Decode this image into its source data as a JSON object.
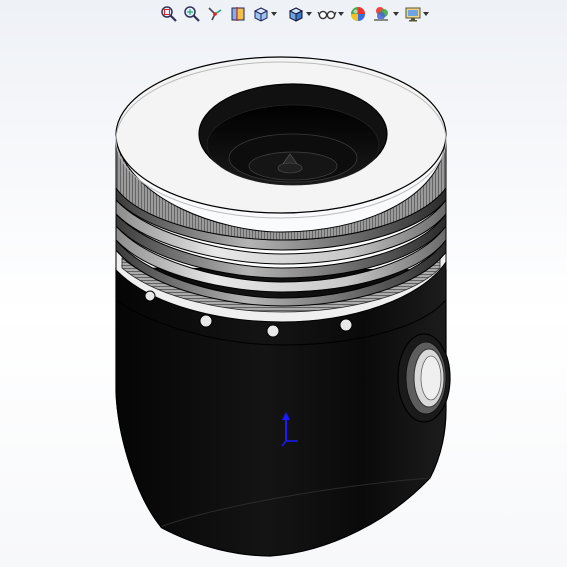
{
  "window": {
    "background_top": "#eef1f6",
    "background_bottom": "#ffffff"
  },
  "heads_up_toolbar": {
    "buttons": [
      {
        "name": "zoom-to-fit",
        "icon": "magnifier-fit-icon",
        "dropdown": false
      },
      {
        "name": "zoom-to-area",
        "icon": "magnifier-area-icon",
        "dropdown": false
      },
      {
        "name": "previous-view",
        "icon": "previous-view-icon",
        "dropdown": false
      },
      {
        "name": "section-view",
        "icon": "section-view-icon",
        "dropdown": false
      },
      {
        "name": "view-orientation",
        "icon": "view-orientation-icon",
        "dropdown": true
      },
      {
        "name": "display-style",
        "icon": "display-style-cube-icon",
        "dropdown": true
      },
      {
        "name": "hide-show-items",
        "icon": "glasses-icon",
        "dropdown": true
      },
      {
        "name": "edit-appearance",
        "icon": "color-ball-icon",
        "dropdown": false
      },
      {
        "name": "apply-scene",
        "icon": "scene-icon",
        "dropdown": true
      },
      {
        "name": "view-settings",
        "icon": "monitor-settings-icon",
        "dropdown": true
      }
    ]
  },
  "model": {
    "part": "piston",
    "body_color": "#0b0b0b",
    "crown_color": "#f4f4f4",
    "ring_band_color": "#dcdcdc",
    "edge_color": "#000000"
  },
  "triad": {
    "axis": "Y",
    "color": "#1a1aff"
  }
}
